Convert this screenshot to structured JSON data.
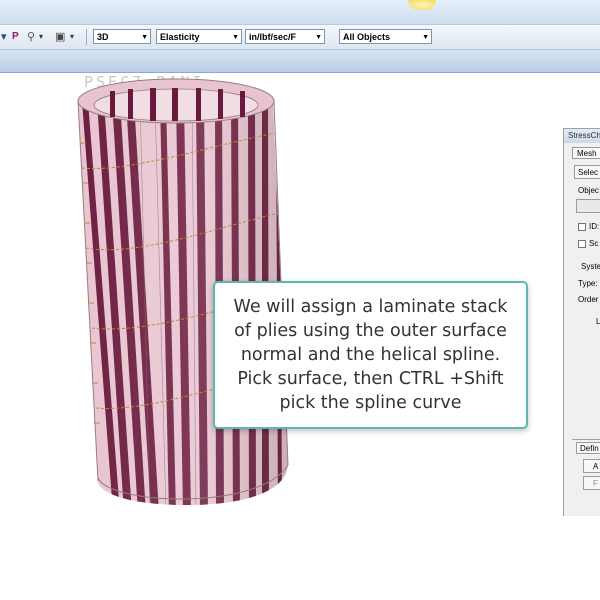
{
  "toolbar": {
    "icons": [
      "dropdown-arrow-icon",
      "p-tool-icon",
      "p-tool-icon-2",
      "pin-tool-icon",
      "camera-tool-icon"
    ],
    "p_glyph": "P",
    "view_combo": "3D",
    "analysis_combo": "Elasticity",
    "units_combo": "in/lbf/sec/F",
    "objects_combo": "All Objects"
  },
  "model": {
    "top_label": "PSEC7 PANI"
  },
  "panel": {
    "title": "StressCh",
    "mesh_tab": "Mesh",
    "select_button": "Selec",
    "object_label": "Objec",
    "id_checkbox": "ID:",
    "sc_checkbox": "Sc",
    "system_label": "Syste",
    "type_label": "Type:",
    "order_label": "Order",
    "l_label": "L",
    "define_tab": "Defin",
    "add_button": "A",
    "f_button": "F"
  },
  "callout": {
    "text": "We will assign a laminate stack of plies using the outer surface normal and the helical spline. Pick surface, then CTRL +Shift pick the spline curve"
  },
  "colors": {
    "cylinder_base": "#e8c4cf",
    "stripe": "#6a1a3c",
    "callout_border": "#5bb8b0",
    "spline": "#c8843a"
  }
}
